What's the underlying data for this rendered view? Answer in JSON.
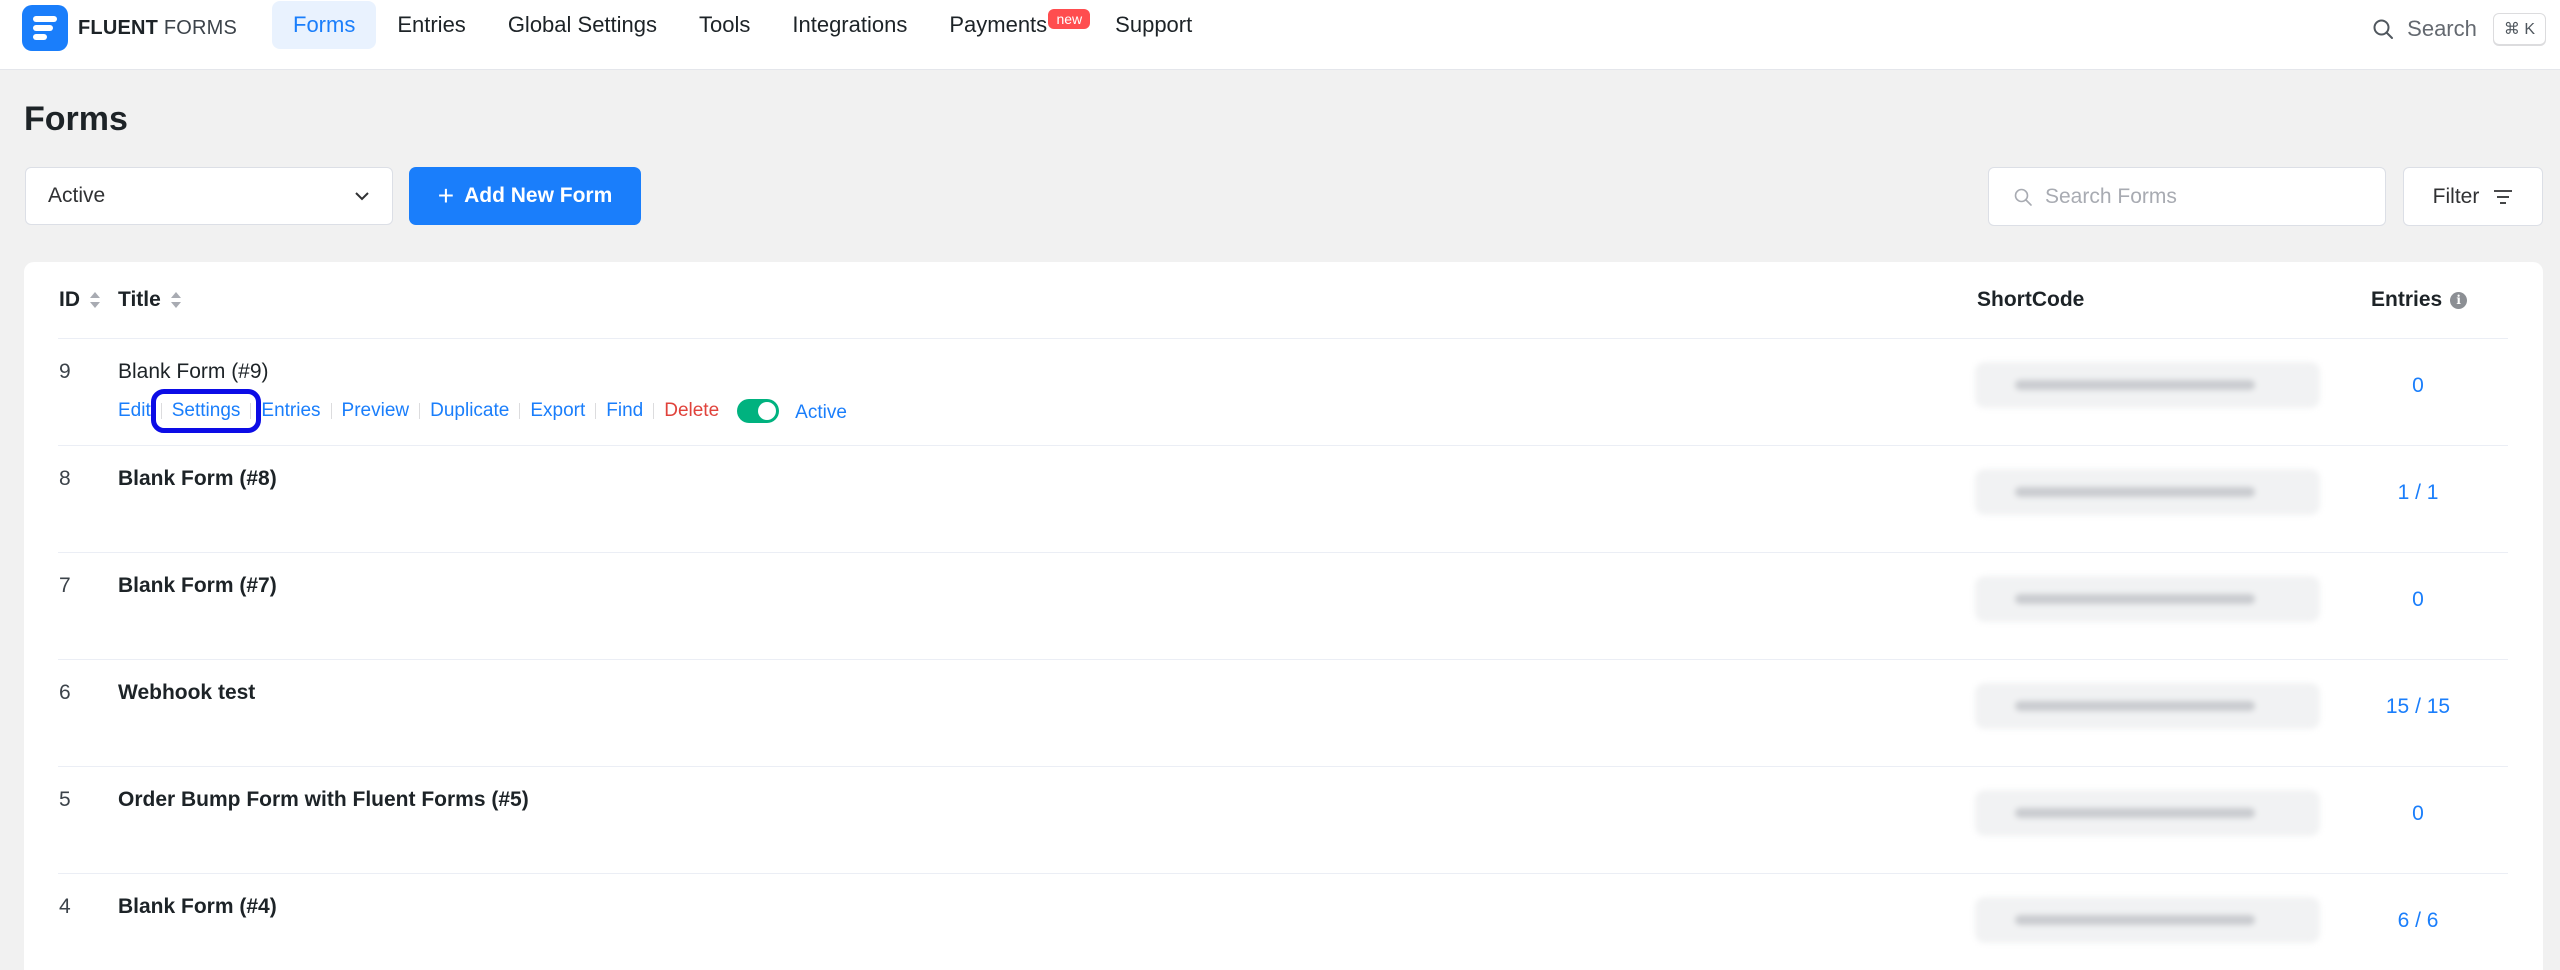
{
  "nav": {
    "logo_bold": "FLUENT",
    "logo_light": "FORMS",
    "items": [
      {
        "label": "Forms"
      },
      {
        "label": "Entries"
      },
      {
        "label": "Global Settings"
      },
      {
        "label": "Tools"
      },
      {
        "label": "Integrations"
      },
      {
        "label": "Payments",
        "badge": "new"
      },
      {
        "label": "Support"
      }
    ],
    "search_label": "Search",
    "shortcut": "⌘ K"
  },
  "page": {
    "title": "Forms",
    "status_filter": "Active",
    "add_button": "Add New Form",
    "search_placeholder": "Search Forms",
    "filter_button": "Filter"
  },
  "table": {
    "columns": {
      "id": "ID",
      "title": "Title",
      "shortcode": "ShortCode",
      "entries": "Entries"
    },
    "row_actions": {
      "edit": "Edit",
      "settings": "Settings",
      "entries": "Entries",
      "preview": "Preview",
      "duplicate": "Duplicate",
      "export": "Export",
      "find": "Find",
      "delete": "Delete",
      "status": "Active"
    },
    "rows": [
      {
        "id": "9",
        "title": "Blank Form (#9)",
        "entries": "0"
      },
      {
        "id": "8",
        "title": "Blank Form (#8)",
        "entries": "1 / 1"
      },
      {
        "id": "7",
        "title": "Blank Form (#7)",
        "entries": "0"
      },
      {
        "id": "6",
        "title": "Webhook test",
        "entries": "15 / 15"
      },
      {
        "id": "5",
        "title": "Order Bump Form with Fluent Forms (#5)",
        "entries": "0"
      },
      {
        "id": "4",
        "title": "Blank Form (#4)",
        "entries": "6 / 6"
      }
    ]
  },
  "colors": {
    "accent": "#1a7efb",
    "danger": "#e0423b",
    "toggle_on": "#00b27f",
    "highlight_box": "#0c0ce6"
  }
}
